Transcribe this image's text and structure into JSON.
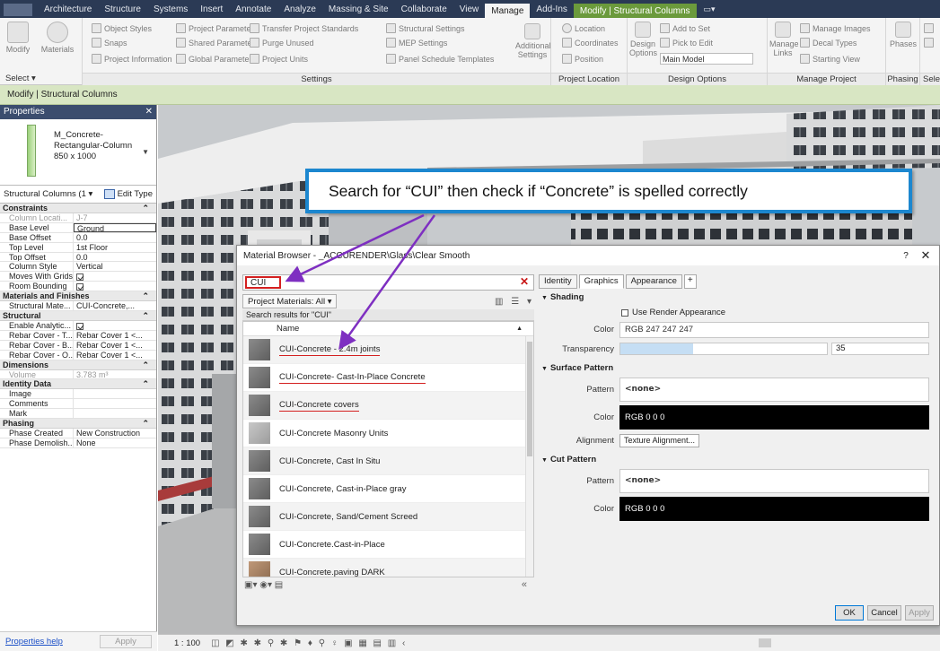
{
  "ribbon_tabs": [
    {
      "label": "Architecture"
    },
    {
      "label": "Structure"
    },
    {
      "label": "Systems"
    },
    {
      "label": "Insert"
    },
    {
      "label": "Annotate"
    },
    {
      "label": "Analyze"
    },
    {
      "label": "Massing & Site"
    },
    {
      "label": "Collaborate"
    },
    {
      "label": "View"
    },
    {
      "label": "Manage",
      "active": true
    },
    {
      "label": "Add-Ins"
    },
    {
      "label": "Modify | Structural Columns",
      "context": true
    }
  ],
  "ribbon": {
    "modify": "Modify",
    "materials": "Materials",
    "object_styles": "Object Styles",
    "snaps": "Snaps",
    "project_information": "Project Information",
    "project_parameters": "Project Parameters",
    "shared_parameters": "Shared Parameters",
    "global_parameters": "Global Parameters",
    "transfer_project_standards": "Transfer Project Standards",
    "purge_unused": "Purge Unused",
    "project_units": "Project Units",
    "structural_settings": "Structural Settings",
    "mep_settings": "MEP Settings",
    "panel_schedule_templates": "Panel Schedule Templates",
    "additional_settings_1": "Additional",
    "additional_settings_2": "Settings",
    "settings_panel": "Settings",
    "location": "Location",
    "coordinates": "Coordinates",
    "position": "Position",
    "project_location_panel": "Project Location",
    "design": "Design",
    "options": "Options",
    "add_to_set": "Add to Set",
    "pick_to_edit": "Pick to Edit",
    "main_model": "Main Model",
    "design_options_panel": "Design Options",
    "manage": "Manage",
    "links": "Links",
    "manage_images": "Manage Images",
    "decal_types": "Decal Types",
    "starting_view": "Starting View",
    "manage_project_panel": "Manage Project",
    "phases": "Phases",
    "phasing_panel": "Phasing",
    "selection_panel": "Sele",
    "select": "Select ▾"
  },
  "options_bar": "Modify | Structural Columns",
  "properties": {
    "title": "Properties",
    "type_name": "M_Concrete-Rectangular-Column 850 x 1000",
    "instance_filter": "Structural Columns (1 ▾",
    "edit_type": "Edit Type",
    "help_link": "Properties help",
    "apply": "Apply",
    "groups": [
      {
        "name": "Constraints",
        "rows": [
          {
            "k": "Column Locati...",
            "v": "J-7",
            "dim": true
          },
          {
            "k": "Base Level",
            "v": "Ground",
            "boxed": true
          },
          {
            "k": "Base Offset",
            "v": "0.0"
          },
          {
            "k": "Top Level",
            "v": "1st Floor"
          },
          {
            "k": "Top Offset",
            "v": "0.0"
          },
          {
            "k": "Column Style",
            "v": "Vertical"
          },
          {
            "k": "Moves With Grids",
            "check": true
          },
          {
            "k": "Room Bounding",
            "check": true
          }
        ]
      },
      {
        "name": "Materials and Finishes",
        "rows": [
          {
            "k": "Structural Mate...",
            "v": "CUI-Concrete,..."
          }
        ]
      },
      {
        "name": "Structural",
        "rows": [
          {
            "k": "Enable Analytic...",
            "check": true
          },
          {
            "k": "Rebar Cover - T...",
            "v": "Rebar Cover 1 <..."
          },
          {
            "k": "Rebar Cover - B...",
            "v": "Rebar Cover 1 <..."
          },
          {
            "k": "Rebar Cover - O...",
            "v": "Rebar Cover 1 <..."
          }
        ]
      },
      {
        "name": "Dimensions",
        "rows": [
          {
            "k": "Volume",
            "v": "3.783 m³",
            "dim": true
          }
        ]
      },
      {
        "name": "Identity Data",
        "rows": [
          {
            "k": "Image",
            "v": ""
          },
          {
            "k": "Comments",
            "v": ""
          },
          {
            "k": "Mark",
            "v": ""
          }
        ]
      },
      {
        "name": "Phasing",
        "rows": [
          {
            "k": "Phase Created",
            "v": "New Construction"
          },
          {
            "k": "Phase Demolish...",
            "v": "None"
          }
        ]
      }
    ]
  },
  "status_bar": {
    "scale": "1 : 100",
    "icons": "◫ ◩ ✱ ✱ ⚲ ✱ ⚑ ♦ ⚲ ♀ ▣ ▦ ▤ ▥ ‹"
  },
  "callout": "Search for “CUI” then check if “Concrete” is spelled correctly",
  "material_browser": {
    "title": "Material Browser - _ACCURENDER\\Glass\\Clear Smooth",
    "help": "?",
    "close": "✕",
    "search_value": "CUI",
    "search_clear": "✕",
    "library_dropdown": "Project Materials: All ▾",
    "list_tools": "▥ ☰ ▾",
    "results_label": "Search results for \"CUI\"",
    "name_header": "Name",
    "materials": [
      {
        "name": "CUI-Concrete - 2.4m joints",
        "underline": true,
        "swatch": "dark"
      },
      {
        "name": "CUI-Concrete- Cast-In-Place Concrete",
        "underline": true,
        "swatch": "dark"
      },
      {
        "name": "CUI-Concrete covers",
        "underline": true,
        "swatch": "dark"
      },
      {
        "name": "CUI-Concrete Masonry Units",
        "underline": false,
        "swatch": "light"
      },
      {
        "name": "CUI-Concrete, Cast In Situ",
        "underline": false,
        "swatch": "dark"
      },
      {
        "name": "CUI-Concrete, Cast-in-Place gray",
        "underline": false,
        "swatch": "dark"
      },
      {
        "name": "CUI-Concrete, Sand/Cement Screed",
        "underline": false,
        "swatch": "dark"
      },
      {
        "name": "CUI-Concrete.Cast-in-Place",
        "underline": false,
        "swatch": "dark"
      },
      {
        "name": "CUI-Concrete.paving DARK",
        "underline": false,
        "swatch": "tan"
      }
    ],
    "bottom_tools": "▣▾ ◉▾ ▤",
    "collapse": "«",
    "tabs": [
      {
        "label": "Identity"
      },
      {
        "label": "Graphics",
        "active": true
      },
      {
        "label": "Appearance"
      },
      {
        "label": "+"
      }
    ],
    "shading": {
      "title": "Shading",
      "use_render_appearance": "Use Render Appearance",
      "color_label": "Color",
      "color_value": "RGB 247 247 247",
      "transparency_label": "Transparency",
      "transparency_value": "35",
      "transparency": 0.35
    },
    "surface_pattern": {
      "title": "Surface Pattern",
      "pattern_label": "Pattern",
      "pattern_value": "<none>",
      "color_label": "Color",
      "color_value": "RGB 0 0 0",
      "alignment_label": "Alignment",
      "alignment_button": "Texture Alignment..."
    },
    "cut_pattern": {
      "title": "Cut Pattern",
      "pattern_label": "Pattern",
      "pattern_value": "<none>",
      "color_label": "Color",
      "color_value": "RGB 0 0 0"
    },
    "buttons": {
      "ok": "OK",
      "cancel": "Cancel",
      "apply": "Apply"
    }
  },
  "colors": {
    "accent": "#1c87cf",
    "highlight": "#d42020",
    "arrow": "#7e2fc1",
    "context_tab": "#6b9a3c"
  }
}
